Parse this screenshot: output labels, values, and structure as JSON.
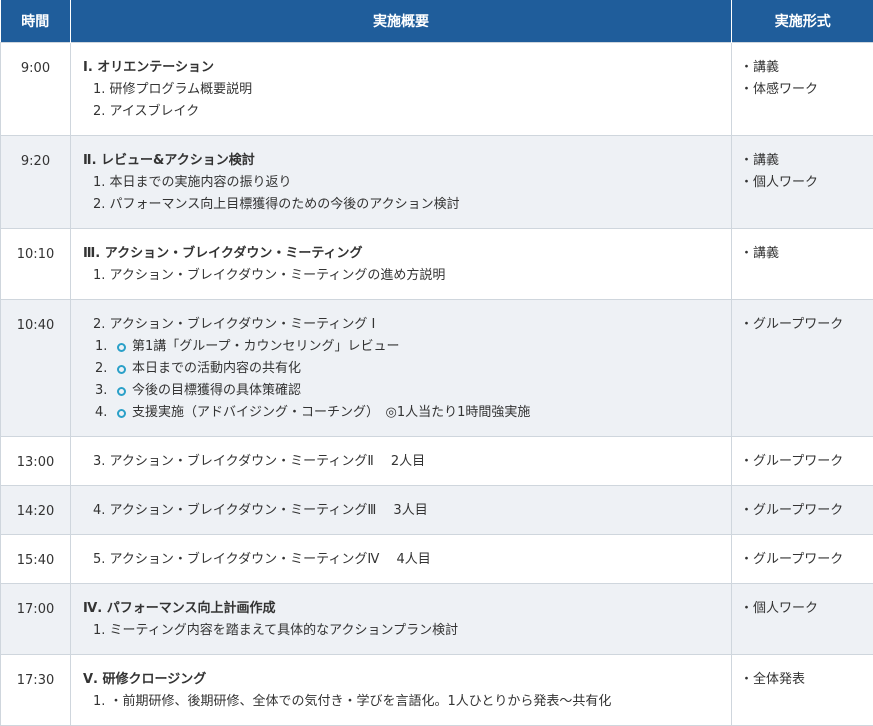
{
  "header": {
    "time": "時間",
    "summary": "実施概要",
    "format": "実施形式"
  },
  "rows": [
    {
      "time": "9:00",
      "heading": "Ⅰ. オリエンテーション",
      "lines": [
        "1. 研修プログラム概要説明",
        "2. アイスブレイク"
      ],
      "formats": [
        "・講義",
        "・体感ワーク"
      ]
    },
    {
      "time": "9:20",
      "heading": "Ⅱ. レビュー&アクション検討",
      "lines": [
        "1. 本日までの実施内容の振り返り",
        "2. パフォーマンス向上目標獲得のための今後のアクション検討"
      ],
      "formats": [
        "・講義",
        "・個人ワーク"
      ]
    },
    {
      "time": "10:10",
      "heading": "Ⅲ. アクション・ブレイクダウン・ミーティング",
      "lines": [
        "1. アクション・ブレイクダウン・ミーティングの進め方説明"
      ],
      "formats": [
        "・講義"
      ]
    },
    {
      "time": "10:40",
      "lines": [
        "2. アクション・ブレイクダウン・ミーティング Ⅰ"
      ],
      "subitems": [
        {
          "num": "1.",
          "text": "第1講「グループ・カウンセリング」レビュー"
        },
        {
          "num": "2.",
          "text": "本日までの活動内容の共有化"
        },
        {
          "num": "3.",
          "text": "今後の目標獲得の具体策確認"
        },
        {
          "num": "4.",
          "text": "支援実施（アドバイジング・コーチング）　◎1人当たり1時間強実施"
        }
      ],
      "formats": [
        "・グループワーク"
      ]
    },
    {
      "time": "13:00",
      "lines": [
        "3. アクション・ブレイクダウン・ミーティングⅡ　 2人目"
      ],
      "formats": [
        "・グループワーク"
      ]
    },
    {
      "time": "14:20",
      "lines": [
        "4. アクション・ブレイクダウン・ミーティングⅢ　 3人目"
      ],
      "formats": [
        "・グループワーク"
      ]
    },
    {
      "time": "15:40",
      "lines": [
        "5. アクション・ブレイクダウン・ミーティングⅣ　 4人目"
      ],
      "formats": [
        "・グループワーク"
      ]
    },
    {
      "time": "17:00",
      "heading": "Ⅳ. パフォーマンス向上計画作成",
      "lines": [
        "1. ミーティング内容を踏まえて具体的なアクションプラン検討"
      ],
      "formats": [
        "・個人ワーク"
      ]
    },
    {
      "time": "17:30",
      "heading": "Ⅴ. 研修クロージング",
      "lines": [
        "1. ・前期研修、後期研修、全体での気付き・学びを言語化。1人ひとりから発表〜共有化"
      ],
      "formats": [
        "・全体発表"
      ]
    }
  ]
}
